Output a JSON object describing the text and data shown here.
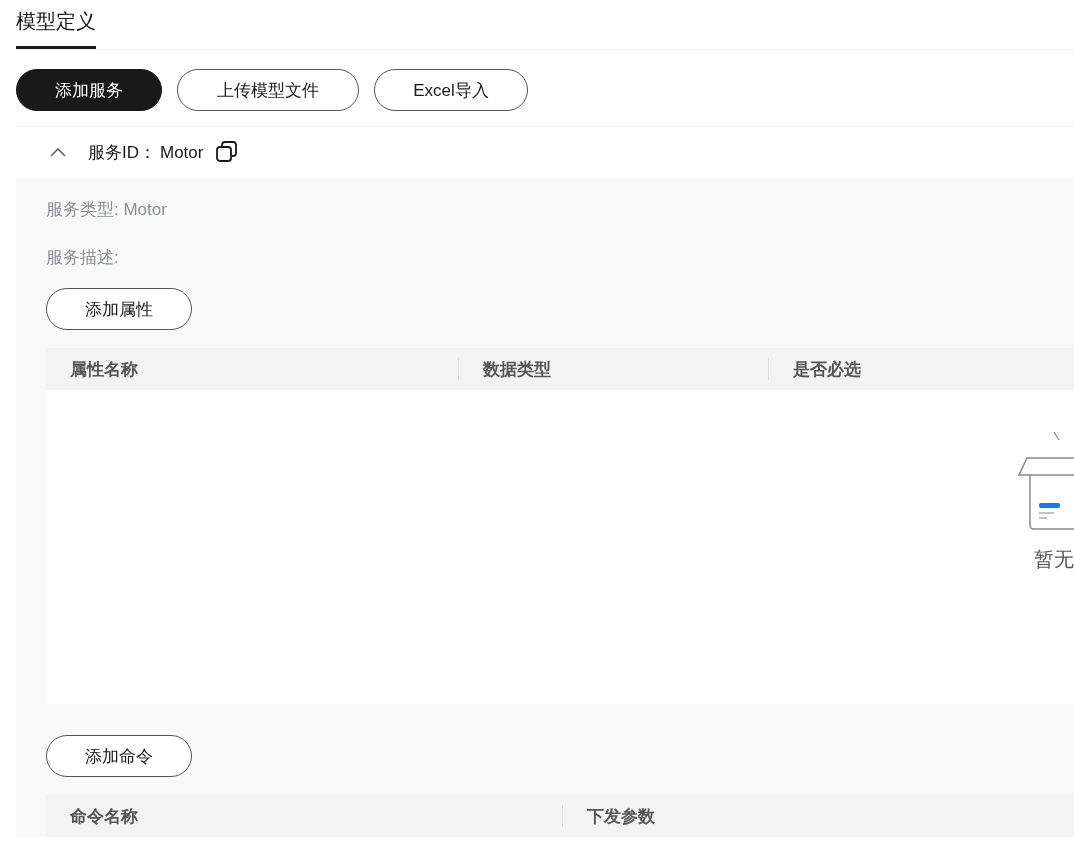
{
  "tabs": [
    {
      "label": "模型定义",
      "selected": true
    }
  ],
  "toolbar": [
    {
      "label": "添加服务",
      "kind": "primary"
    },
    {
      "label": "上传模型文件",
      "kind": "outline"
    },
    {
      "label": "Excel导入",
      "kind": "outline"
    }
  ],
  "services": [
    {
      "id_label": "服务ID：",
      "id": "Motor",
      "expanded": true,
      "type_line": "服务类型: Motor",
      "description_line": "服务描述:",
      "properties": {
        "add_button": "添加属性",
        "columns": [
          "属性名称",
          "数据类型",
          "是否必选"
        ],
        "empty_text": "暂无"
      },
      "commands": {
        "add_button": "添加命令",
        "columns": [
          "命令名称",
          "下发参数"
        ]
      }
    }
  ]
}
